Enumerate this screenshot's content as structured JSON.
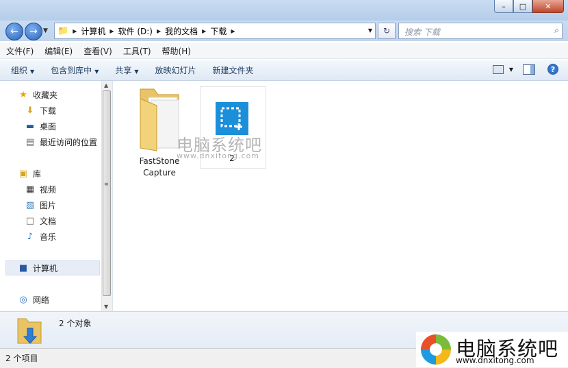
{
  "window": {
    "minimize_glyph": "–",
    "maximize_glyph": "□",
    "close_glyph": "✕"
  },
  "address": {
    "crumbs": [
      "计算机",
      "软件 (D:)",
      "我的文档",
      "下载"
    ],
    "search_placeholder": "搜索 下载"
  },
  "menu": [
    "文件(F)",
    "编辑(E)",
    "查看(V)",
    "工具(T)",
    "帮助(H)"
  ],
  "commands": {
    "organize": "组织",
    "include_library": "包含到库中",
    "share": "共享",
    "slideshow": "放映幻灯片",
    "new_folder": "新建文件夹"
  },
  "nav": {
    "favorites": "收藏夹",
    "downloads": "下载",
    "desktop": "桌面",
    "recent": "最近访问的位置",
    "libraries": "库",
    "videos": "视频",
    "pictures": "图片",
    "documents": "文档",
    "music": "音乐",
    "computer": "计算机",
    "network": "网络"
  },
  "files": [
    {
      "name": "FastStone Capture",
      "icon": "folder-icon"
    },
    {
      "name": "2",
      "icon": "screenshot-app-icon"
    }
  ],
  "details": {
    "count_text": "2 个对象"
  },
  "status": {
    "items_text": "2 个项目"
  },
  "watermark": {
    "title": "电脑系统吧",
    "url": "www.dnxitong.com"
  },
  "colors": {
    "accent": "#1b8fd9",
    "titlebar": "#c9dcf2"
  }
}
